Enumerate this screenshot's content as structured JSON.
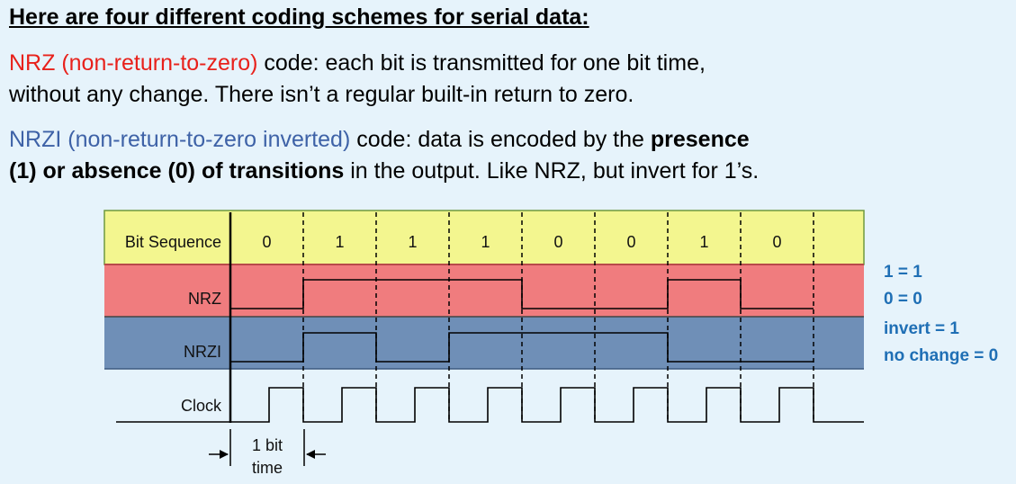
{
  "heading": "Here are four different coding schemes for serial data:",
  "nrz_paragraph": {
    "term": "NRZ (non-return-to-zero)",
    "line1_rest": " code: each bit is transmitted for one bit time,",
    "line2": "without any change. There isn’t a regular built-in return to zero."
  },
  "nrzi_paragraph": {
    "term": "NRZI (non-return-to-zero inverted)",
    "line1_mid": " code: data is encoded by the ",
    "line1_bold": "presence",
    "line2_bold": "(1) or absence (0) of transitions",
    "line2_rest": " in the output. Like NRZ, but invert for 1’s."
  },
  "diagram": {
    "row_labels": {
      "bit_sequence": "Bit Sequence",
      "nrz": "NRZ",
      "nrzi": "NRZI",
      "clock": "Clock"
    },
    "bits": [
      "0",
      "1",
      "1",
      "1",
      "0",
      "0",
      "1",
      "0"
    ],
    "bit_time_label": [
      "1 bit",
      "time"
    ],
    "colors": {
      "bit_row": "#f3f68f",
      "nrz_row": "#f07c7e",
      "nrzi_row": "#6f8fb7"
    }
  },
  "notes": {
    "nrz_rule_1": "1 = 1",
    "nrz_rule_0": "0 = 0",
    "nrzi_rule_1": "invert = 1",
    "nrzi_rule_0": "no change = 0"
  }
}
